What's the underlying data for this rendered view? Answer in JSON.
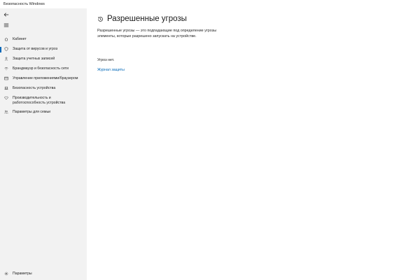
{
  "window": {
    "title": "Безопасность Windows"
  },
  "sidebar": {
    "items": [
      {
        "label": "Кабинет",
        "icon": "home-icon"
      },
      {
        "label": "Защита от вирусов и угроз",
        "icon": "shield-icon",
        "active": true
      },
      {
        "label": "Защита учетных записей",
        "icon": "person-icon"
      },
      {
        "label": "Брандмауэр и безопасность сети",
        "icon": "wifi-icon"
      },
      {
        "label": "Управление приложениями/браузером",
        "icon": "app-window-icon"
      },
      {
        "label": "Безопасность устройства",
        "icon": "laptop-icon"
      },
      {
        "label": "Производительность и работоспособность устройства",
        "icon": "heart-icon"
      },
      {
        "label": "Параметры для семьи",
        "icon": "family-icon"
      }
    ],
    "settings_label": "Параметры"
  },
  "main": {
    "title": "Разрешенные угрозы",
    "description": "Разрешенные угрозы — это подпадающие под определение угрозы элементы, которые разрешено запускать на устройстве.",
    "no_threats_text": "Угроз нет.",
    "history_link": "Журнал защиты"
  },
  "colors": {
    "accent": "#0067b8",
    "sidebar_bg": "#f2f2f2",
    "main_bg": "#ffffff"
  }
}
